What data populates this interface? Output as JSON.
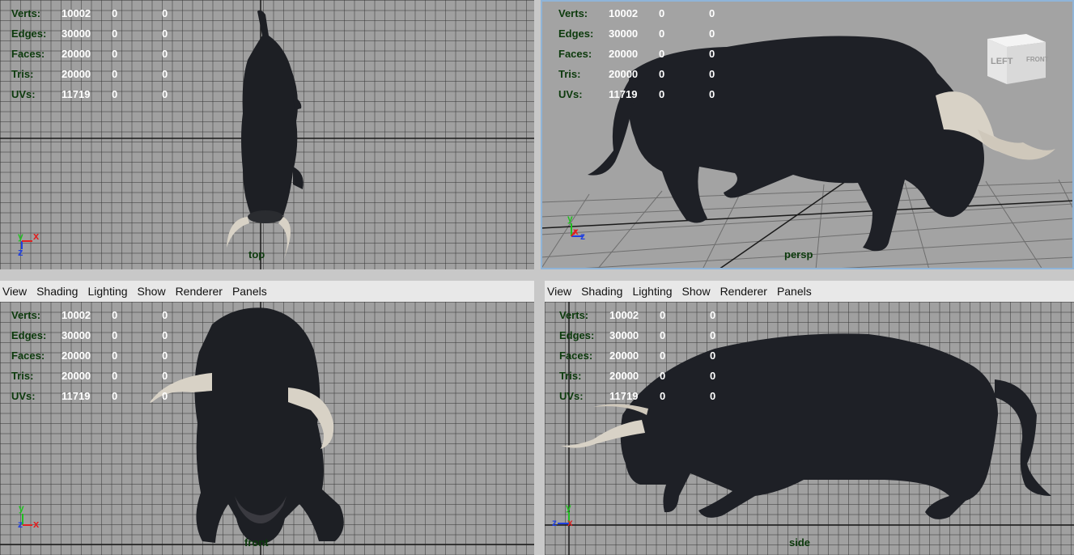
{
  "menu": {
    "view": "View",
    "shading": "Shading",
    "lighting": "Lighting",
    "show": "Show",
    "renderer": "Renderer",
    "panels": "Panels"
  },
  "hud": {
    "labels": {
      "verts": "Verts:",
      "edges": "Edges:",
      "faces": "Faces:",
      "tris": "Tris:",
      "uvs": "UVs:"
    },
    "values": {
      "verts": "10002",
      "edges": "30000",
      "faces": "20000",
      "tris": "20000",
      "uvs": "11719"
    },
    "zero": "0"
  },
  "cameras": {
    "top": "top",
    "persp": "persp",
    "front": "front",
    "side": "side"
  },
  "view_cube": {
    "left": "LEFT",
    "front": "FRONT"
  },
  "axis_labels": {
    "x": "x",
    "y": "y",
    "z": "z"
  },
  "colors": {
    "viewport_bg": "#a0a0a0",
    "hud_label": "#0c3a0c",
    "axis_x": "#e02020",
    "axis_y": "#20c020",
    "axis_z": "#2040e0",
    "active_border": "#8fb4d8"
  }
}
